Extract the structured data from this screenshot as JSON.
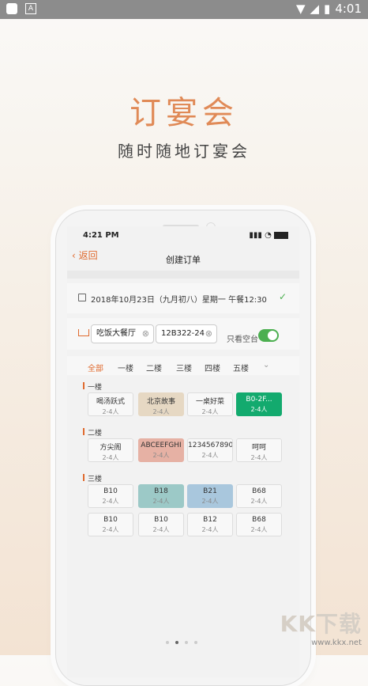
{
  "android_status": {
    "time": "4:01"
  },
  "headline": "订宴会",
  "subline": "随时随地订宴会",
  "phone_status": {
    "time": "4:21 PM"
  },
  "nav": {
    "back_label": "返回",
    "title": "创建订单"
  },
  "date_row": {
    "text": "2018年10月23日（九月初八）星期一 午餐12:30"
  },
  "selectors": {
    "room": "吃饭大餐厅",
    "code": "12B322-24",
    "free_only_label": "只看空台",
    "free_only": true
  },
  "tabs": [
    "全部",
    "一楼",
    "二楼",
    "三楼",
    "四楼",
    "五楼"
  ],
  "floors": [
    {
      "label": "一楼",
      "tables": [
        {
          "name": "喝汤跃式",
          "cap": "2-4人",
          "status": "default"
        },
        {
          "name": "北京故事",
          "cap": "2-4人",
          "status": "beige"
        },
        {
          "name": "一桌好菜",
          "cap": "2-4人",
          "status": "default"
        },
        {
          "name": "B0-2F...",
          "cap": "2-4人",
          "status": "green"
        }
      ]
    },
    {
      "label": "二楼",
      "tables": [
        {
          "name": "方尖阁",
          "cap": "2-4人",
          "status": "default"
        },
        {
          "name": "ABCEEFGHI",
          "cap": "2-4人",
          "status": "pink"
        },
        {
          "name": "1234567890",
          "cap": "2-4人",
          "status": "default"
        },
        {
          "name": "呵呵",
          "cap": "2-4人",
          "status": "default"
        }
      ]
    },
    {
      "label": "三楼",
      "tables": [
        {
          "name": "B10",
          "cap": "2-4人",
          "status": "default"
        },
        {
          "name": "B18",
          "cap": "2-4人",
          "status": "teal"
        },
        {
          "name": "B21",
          "cap": "2-4人",
          "status": "blue"
        },
        {
          "name": "B68",
          "cap": "2-4人",
          "status": "default"
        },
        {
          "name": "B10",
          "cap": "2-4人",
          "status": "default"
        },
        {
          "name": "B10",
          "cap": "2-4人",
          "status": "default"
        },
        {
          "name": "B12",
          "cap": "2-4人",
          "status": "default"
        },
        {
          "name": "B68",
          "cap": "2-4人",
          "status": "default"
        }
      ]
    }
  ],
  "watermark": {
    "big": "KK下载",
    "small": "www.kkx.net"
  }
}
